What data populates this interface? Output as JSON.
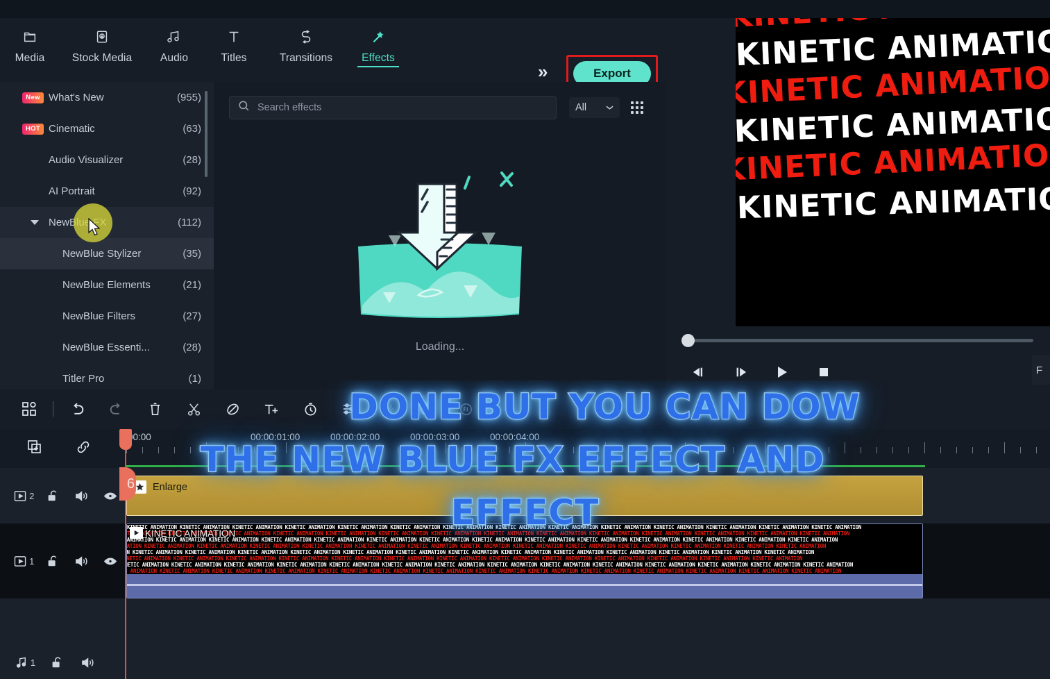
{
  "app": {
    "nav": [
      {
        "label": "Media",
        "icon": "folder-icon",
        "active": false
      },
      {
        "label": "Stock Media",
        "icon": "stock-media-icon",
        "active": false
      },
      {
        "label": "Audio",
        "icon": "music-note-icon",
        "active": false
      },
      {
        "label": "Titles",
        "icon": "text-t-icon",
        "active": false
      },
      {
        "label": "Transitions",
        "icon": "transitions-icon",
        "active": false
      },
      {
        "label": "Effects",
        "icon": "magic-wand-icon",
        "active": true
      }
    ],
    "more_label": "»",
    "export_label": "Export",
    "export_highlight_color": "#e01b1b",
    "export_bg_color": "#5fe3cd",
    "accent_color": "#4fe0c8"
  },
  "sidebar": {
    "items": [
      {
        "label": "What's New",
        "count": "(955)",
        "badge": "New",
        "indent": 0,
        "selected": false,
        "hover": false
      },
      {
        "label": "Cinematic",
        "count": "(63)",
        "badge": "HOT",
        "indent": 0,
        "selected": false,
        "hover": false
      },
      {
        "label": "Audio Visualizer",
        "count": "(28)",
        "badge": "",
        "indent": 0,
        "selected": false,
        "hover": false
      },
      {
        "label": "AI Portrait",
        "count": "(92)",
        "badge": "",
        "indent": 0,
        "selected": false,
        "hover": false
      },
      {
        "label": "NewBlue FX",
        "count": "(112)",
        "badge": "",
        "indent": 0,
        "selected": false,
        "hover": true,
        "caret": true
      },
      {
        "label": "NewBlue Stylizer",
        "count": "(35)",
        "badge": "",
        "indent": 1,
        "selected": true,
        "hover": false
      },
      {
        "label": "NewBlue Elements",
        "count": "(21)",
        "badge": "",
        "indent": 1,
        "selected": false,
        "hover": false
      },
      {
        "label": "NewBlue Filters",
        "count": "(27)",
        "badge": "",
        "indent": 1,
        "selected": false,
        "hover": false
      },
      {
        "label": "NewBlue Essenti...",
        "count": "(28)",
        "badge": "",
        "indent": 1,
        "selected": false,
        "hover": false
      },
      {
        "label": "Titler Pro",
        "count": "(1)",
        "badge": "",
        "indent": 1,
        "selected": false,
        "hover": false
      }
    ]
  },
  "effects_panel": {
    "search_placeholder": "Search effects",
    "search_value": "",
    "filter_label": "All",
    "grid_icon": "grid-view-icon",
    "loading_text": "Loading..."
  },
  "preview": {
    "text_lines": [
      {
        "text": "KINETIC ANIMATION K",
        "color": "red"
      },
      {
        "text": "KINETIC ANIMATION",
        "color": "white"
      },
      {
        "text": "KINETIC ANIMATION",
        "color": "red"
      },
      {
        "text": "KINETIC ANIMATION",
        "color": "white"
      },
      {
        "text": "KINETIC ANIMATION",
        "color": "red"
      },
      {
        "text": "KINETIC ANIMATION",
        "color": "white"
      }
    ],
    "controls": [
      {
        "name": "previous-frame-button",
        "glyph": "prev-frame-icon"
      },
      {
        "name": "next-frame-button",
        "glyph": "next-frame-icon"
      },
      {
        "name": "play-button",
        "glyph": "play-icon"
      },
      {
        "name": "stop-button",
        "glyph": "stop-icon"
      }
    ],
    "right_edge_label": "F"
  },
  "timeline_toolbar": {
    "icons": [
      {
        "name": "layout-grid-icon"
      },
      {
        "name": "undo-icon"
      },
      {
        "name": "redo-icon"
      },
      {
        "name": "delete-icon"
      },
      {
        "name": "split-scissors-icon"
      },
      {
        "name": "marker-icon"
      },
      {
        "name": "add-text-icon"
      },
      {
        "name": "speed-icon"
      },
      {
        "name": "color-adjust-icon"
      },
      {
        "name": "audio-waveform-icon"
      },
      {
        "name": "audio-ducking-icon"
      },
      {
        "name": "auto-reframe-icon"
      }
    ],
    "header_icons": [
      {
        "name": "add-track-icon"
      },
      {
        "name": "link-icon"
      }
    ]
  },
  "timeline": {
    "ruler_labels": [
      "00:00",
      "00:00:01:00",
      "00:00:02:00",
      "00:00:03:00",
      "00:00:04:00"
    ],
    "tracks": [
      {
        "id": "video-2",
        "type": "video",
        "number": "2",
        "icons": [
          "play-icon",
          "unlock-icon",
          "speaker-icon",
          "eye-icon"
        ]
      },
      {
        "id": "video-1",
        "type": "video",
        "number": "1",
        "icons": [
          "play-icon",
          "unlock-icon",
          "speaker-icon",
          "eye-icon"
        ]
      },
      {
        "id": "audio-1",
        "type": "audio",
        "number": "1",
        "icons": [
          "music-note-icon",
          "unlock-icon",
          "speaker-icon"
        ]
      }
    ],
    "clips": [
      {
        "name": "Enlarge",
        "track": "video-2",
        "icon": "star-icon",
        "color": "#c5a23f"
      },
      {
        "name": "KINETIC ANIMATION",
        "track": "video-1",
        "icon": "play-icon",
        "color": "#000000"
      }
    ]
  },
  "caption": {
    "lines": [
      "DONE BUT YOU CAN DOW",
      "THE NEW BLUE FX EFFECT AND",
      "EFFECT"
    ],
    "fill_color": "#2f6fe8",
    "stroke_color": "#eaf4ff"
  }
}
